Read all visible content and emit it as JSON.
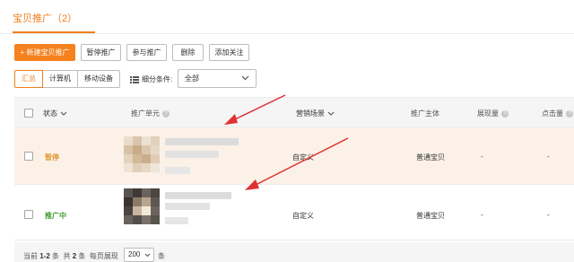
{
  "tabs": {
    "active_label": "宝贝推广（2）"
  },
  "toolbar": {
    "new_button": "+ 新建宝贝推广",
    "pause_button": "暂停推广",
    "join_button": "参与推广",
    "delete_button": "删除",
    "follow_button": "添加关注"
  },
  "device_filter": {
    "options": [
      "汇总",
      "计算机",
      "移动设备"
    ],
    "active": "汇总"
  },
  "filter": {
    "label": "细分条件:",
    "selected": "全部"
  },
  "table": {
    "columns": {
      "status": "状态",
      "unit": "推广单元",
      "scene": "营销场景",
      "subject": "推广主体",
      "impressions": "展现量",
      "clicks": "点击量"
    },
    "rows": [
      {
        "status": "暂停",
        "scene": "自定义",
        "subject": "普通宝贝",
        "impressions": "-",
        "clicks": "-"
      },
      {
        "status": "推广中",
        "scene": "自定义",
        "subject": "普通宝贝",
        "impressions": "-",
        "clicks": "-"
      }
    ]
  },
  "pagination": {
    "current_prefix": "当前",
    "current_range": "1-2",
    "current_suffix": "条",
    "total_prefix": "共",
    "total_count": "2",
    "total_suffix": "条",
    "page_size_label": "每页展现",
    "page_size": "200",
    "page_size_suffix": "条"
  },
  "colors": {
    "accent": "#f07f1b",
    "paused_status": "#e0962a",
    "active_status": "#3e9d2c",
    "annotation_arrow": "#e03030",
    "highlight_row": "#fbf1e7"
  }
}
